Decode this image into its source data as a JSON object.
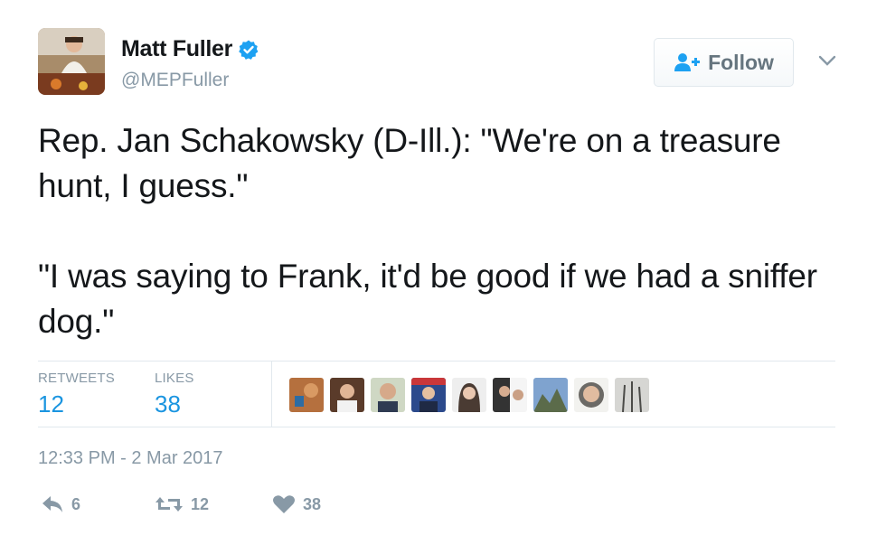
{
  "user": {
    "name": "Matt Fuller",
    "handle": "@MEPFuller",
    "verified": true
  },
  "follow_button": {
    "label": "Follow",
    "icon": "add-user-icon"
  },
  "tweet": {
    "paragraphs": [
      "Rep. Jan Schakowsky (D-Ill.): \"We're on a treasure hunt, I guess.\"",
      "\"I was saying to Frank, it'd be good if we had a sniffer dog.\""
    ]
  },
  "stats": {
    "retweets_label": "RETWEETS",
    "retweets_value": "12",
    "likes_label": "LIKES",
    "likes_value": "38"
  },
  "timestamp": "12:33 PM - 2 Mar 2017",
  "actions": {
    "reply_count": "6",
    "retweet_count": "12",
    "like_count": "38"
  },
  "colors": {
    "accent": "#1b95e0",
    "muted": "#8899a6",
    "verified": "#1da1f2"
  }
}
